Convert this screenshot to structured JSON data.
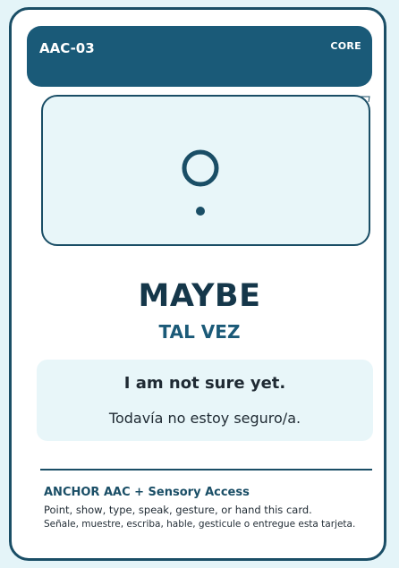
{
  "header": {
    "code": "AAC-03",
    "tag": "CORE"
  },
  "symbol": {
    "icon": "maybe-question-icon"
  },
  "word": {
    "en": "MAYBE",
    "es": "TAL VEZ"
  },
  "phrase": {
    "en": "I am not sure yet.",
    "es": "Todavía no estoy seguro/a."
  },
  "footer": {
    "title": "ANCHOR AAC + Sensory Access",
    "en": "Point, show, type, speak, gesture, or hand this card.",
    "es": "Señale, muestre, escriba, hable, gesticule o entregue esta tarjeta."
  },
  "colors": {
    "primary": "#1a5a78",
    "dark": "#15374a",
    "light_panel": "#e8f6f9",
    "background": "#e4f4f8"
  }
}
